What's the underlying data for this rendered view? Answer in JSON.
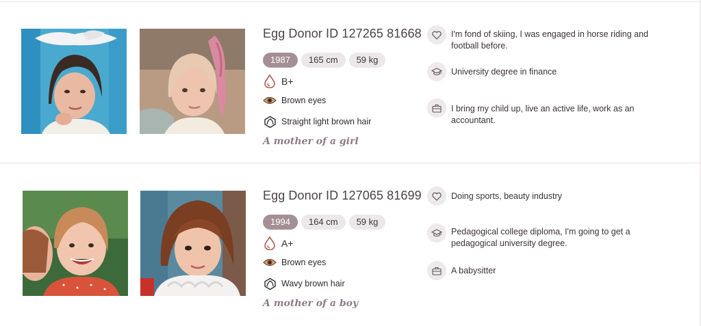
{
  "donors": [
    {
      "id_label": "Egg Donor ID 127265 81668",
      "year": "1987",
      "height": "165 cm",
      "weight": "59 kg",
      "blood_type": "B+",
      "eyes": "Brown eyes",
      "hair": "Straight light brown hair",
      "mother_of": "A mother of a girl",
      "hobbies": "I'm fond of skiing, I was engaged in horse riding and football before.",
      "education": "University degree in finance",
      "occupation": "I bring my child up, live an active life, work as an accountant."
    },
    {
      "id_label": "Egg Donor ID 127065 81699",
      "year": "1994",
      "height": "164 cm",
      "weight": "59 kg",
      "blood_type": "A+",
      "eyes": "Brown eyes",
      "hair": "Wavy brown hair",
      "mother_of": "A mother of a boy",
      "hobbies": "Doing sports, beauty industry",
      "education": "Pedagogical college diploma, I'm going to get a pedagogical university degree.",
      "occupation": "A babysitter"
    }
  ],
  "icons": {
    "blood": "blood-drop-icon",
    "eyes": "eye-icon",
    "hair": "hair-icon",
    "hobbies": "heart-icon",
    "education": "graduation-cap-icon",
    "occupation": "briefcase-icon"
  },
  "colors": {
    "year_chip": "#a48f95",
    "chip": "#ece7e9",
    "mother_text": "#8e7a86",
    "icon_bubble": "#eee9eb"
  }
}
